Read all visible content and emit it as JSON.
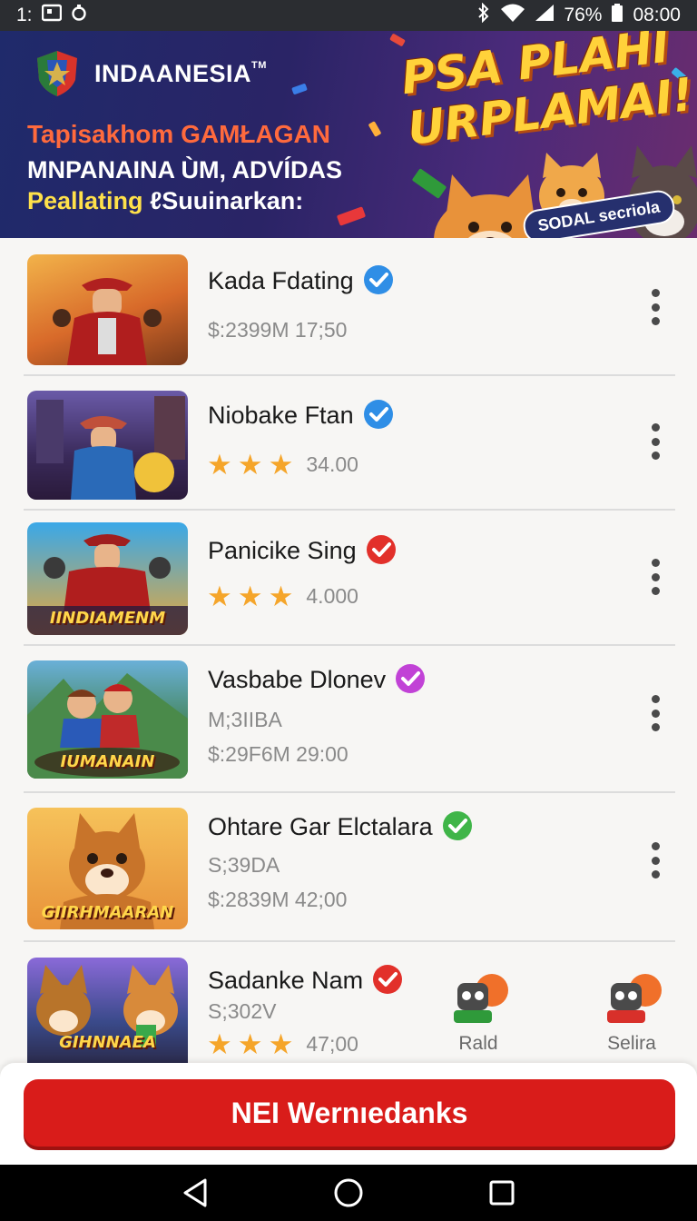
{
  "status_bar": {
    "time_left": "1:",
    "battery": "76%",
    "time": "08:00"
  },
  "banner": {
    "brand": "INDAANESIA",
    "brand_tm": "TM",
    "line1": "Tapisakhom GAMŁAGAN",
    "line2": "MNPANAINA ÙM, ADVÍDAS",
    "line3_yellow": "Peallating",
    "line3_white": "ℓSuuinarkan:",
    "promo_line1": "PSA PLAHI",
    "promo_line2": "URPLAMAI!",
    "promo_tag": "SODAL secriola"
  },
  "apps": [
    {
      "title": "Kada Fdating",
      "badge_color": "#2f8ee6",
      "meta1": "$:2399M  17;50",
      "meta2": "",
      "stars": 0,
      "stars_value": ""
    },
    {
      "title": "Niobake Ftan",
      "badge_color": "#2f8ee6",
      "meta1": "",
      "meta2": "",
      "stars": 3,
      "stars_value": "34.00"
    },
    {
      "title": "Panicike Sing",
      "badge_color": "#e2302a",
      "meta1": "",
      "meta2": "",
      "stars": 3,
      "stars_value": "4.000",
      "thumb_label": "IINDIAMENM"
    },
    {
      "title": "Vasbabe Dlonev",
      "badge_color": "#c142d6",
      "meta1": "M;3IIBA",
      "meta2": "$:29F6M   29:00",
      "stars": 0,
      "stars_value": "",
      "thumb_label": "IUMANAIN"
    },
    {
      "title": "Ohtare Gar Elctalara",
      "badge_color": "#3fb548",
      "meta1": "S;39DA",
      "meta2": "$:2839M  42;00",
      "stars": 0,
      "stars_value": "",
      "thumb_label": "GIIRHMAARAN"
    },
    {
      "title": "Sadanke Nam",
      "badge_color": "#e2302a",
      "meta1": "S;302V",
      "meta2": "",
      "stars": 3,
      "stars_value": "47;00",
      "thumb_label": "GIHNNAEA"
    }
  ],
  "mini_apps": [
    {
      "label": "Rald"
    },
    {
      "label": "Selira"
    }
  ],
  "cta": {
    "label": "NEI Wernıedanks"
  },
  "colors": {
    "cta": "#d91c1a",
    "status_bar": "#2b2d31",
    "star": "#f5a52a"
  }
}
